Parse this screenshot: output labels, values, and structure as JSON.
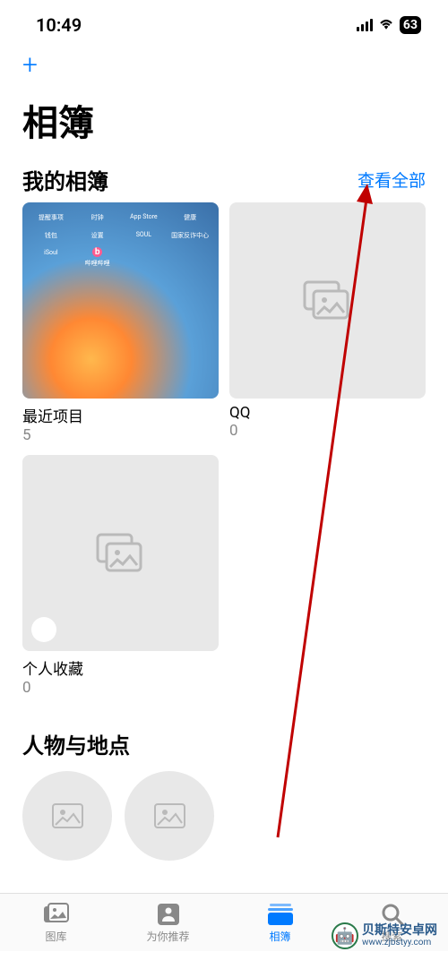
{
  "status": {
    "time": "10:49",
    "battery": "63"
  },
  "header": {
    "add_icon": "+",
    "title": "相簿"
  },
  "sections": {
    "my_albums": {
      "title": "我的相簿",
      "see_all": "查看全部",
      "albums": [
        {
          "name": "最近项目",
          "count": "5"
        },
        {
          "name": "QQ",
          "count": "0"
        },
        {
          "name": "个人收藏",
          "count": "0"
        }
      ]
    },
    "people_places": {
      "title": "人物与地点"
    }
  },
  "tabs": [
    {
      "label": "图库"
    },
    {
      "label": "为你推荐"
    },
    {
      "label": "相簿"
    },
    {
      "label": "搜索"
    }
  ],
  "watermark": {
    "main": "贝斯特安卓网",
    "sub": "www.zjbstyy.com"
  },
  "screenshot_apps": {
    "row1": [
      "提醒事项",
      "时钟",
      "App Store",
      "健康"
    ],
    "row2": [
      "钱包",
      "设置",
      "SOUL",
      "国家反诈中心"
    ],
    "row3": [
      "iSoul",
      "哔哩哔哩",
      "",
      ""
    ]
  }
}
